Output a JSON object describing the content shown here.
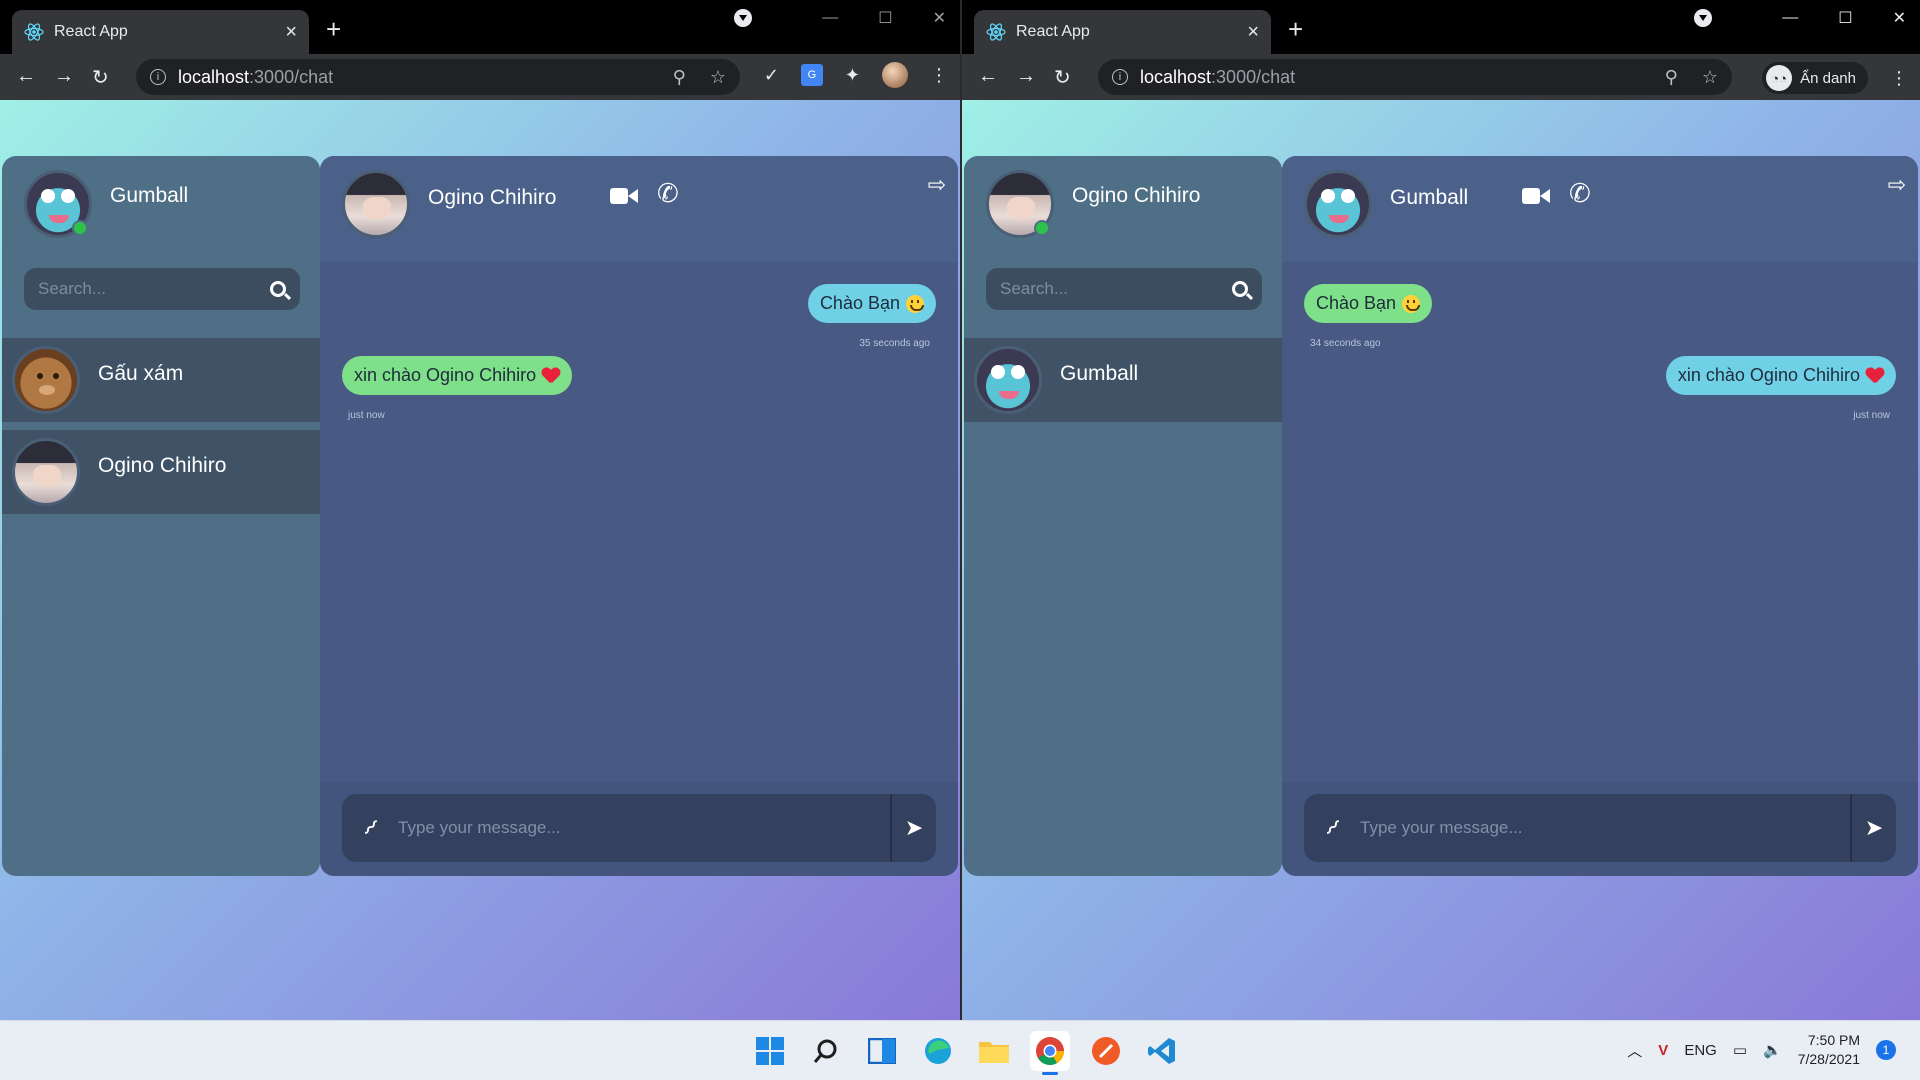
{
  "browser": {
    "tab_title": "React App",
    "url_host": "localhost",
    "url_path": ":3000/chat",
    "incognito_label": "Ẩn danh"
  },
  "left": {
    "me": "Gumball",
    "search_placeholder": "Search...",
    "contacts": [
      "Gấu xám",
      "Ogino Chihiro"
    ],
    "chat_with": "Ogino Chihiro",
    "messages": [
      {
        "text": "Chào Bạn",
        "time": "35 seconds ago",
        "side": "right"
      },
      {
        "text": "xin chào Ogino Chihiro",
        "time": "just now",
        "side": "left"
      }
    ],
    "composer_placeholder": "Type your message..."
  },
  "right": {
    "me": "Ogino Chihiro",
    "search_placeholder": "Search...",
    "contacts": [
      "Gumball"
    ],
    "chat_with": "Gumball",
    "messages": [
      {
        "text": "Chào Bạn",
        "time": "34 seconds ago",
        "side": "left"
      },
      {
        "text": "xin chào Ogino Chihiro",
        "time": "just now",
        "side": "right"
      }
    ],
    "composer_placeholder": "Type your message..."
  },
  "taskbar": {
    "lang": "ENG",
    "time": "7:50 PM",
    "date": "7/28/2021",
    "notifications": "1"
  },
  "icons": [
    "react-icon",
    "search-icon",
    "video-call-icon",
    "phone-icon",
    "logout-icon",
    "paperclip-icon",
    "send-icon",
    "windows-start-icon",
    "chrome-icon",
    "vscode-icon"
  ]
}
